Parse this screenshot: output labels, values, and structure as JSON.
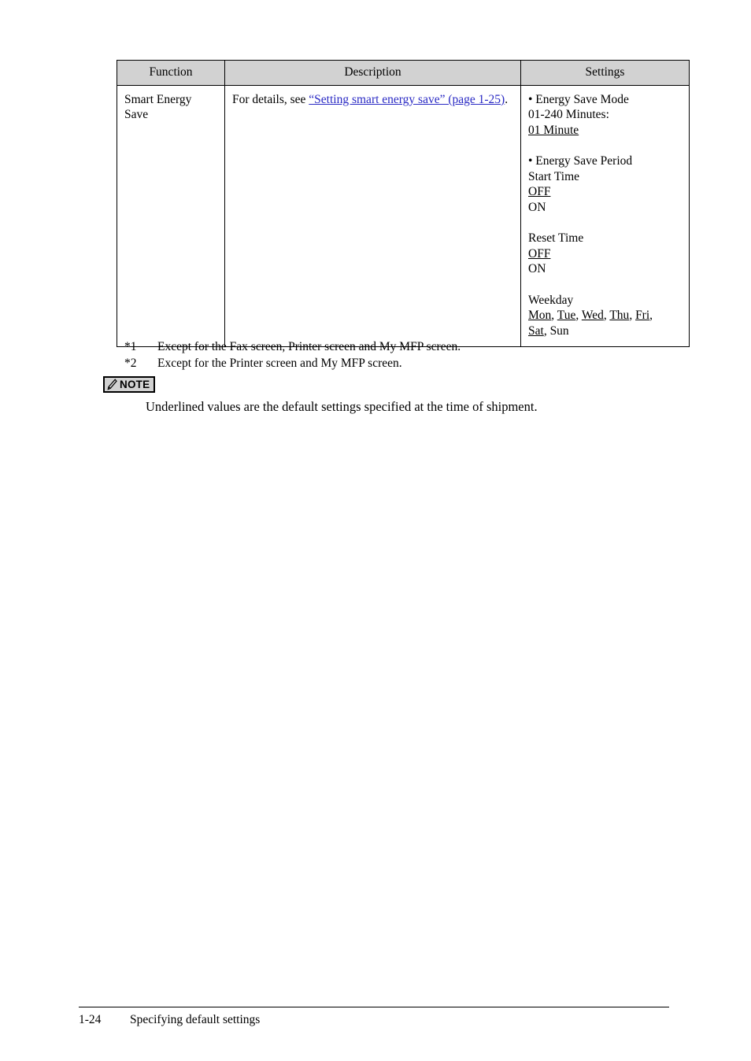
{
  "table": {
    "headers": {
      "function": "Function",
      "description": "Description",
      "settings": "Settings"
    },
    "row": {
      "function": "Smart Energy Save",
      "description": {
        "lead": "For details, see ",
        "link": "“Setting smart energy save” (page 1-25)",
        "trail": "."
      },
      "settings": {
        "group1": {
          "title": "• Energy Save Mode",
          "range": "01-240 Minutes:",
          "default": "01 Minute"
        },
        "group2": {
          "title": "• Energy Save Period",
          "start_time_label": "Start Time",
          "start_time_default": "OFF",
          "start_time_other": "ON",
          "reset_time_label": "Reset Time",
          "reset_time_default": "OFF",
          "reset_time_other": "ON",
          "weekday_label": "Weekday",
          "weekday_mon": "Mon",
          "weekday_sep1": ", ",
          "weekday_tue": "Tue",
          "weekday_sep2": ", ",
          "weekday_wed": "Wed",
          "weekday_sep3": ", ",
          "weekday_thu": "Thu",
          "weekday_sep4": ", ",
          "weekday_fri": "Fri",
          "weekday_sep5": ",",
          "weekday_sat": "Sat",
          "weekday_sep6": ", ",
          "weekday_sun": "Sun"
        }
      }
    }
  },
  "footnotes": [
    {
      "mark": "*1",
      "text": "Except for the Fax screen, Printer screen and My MFP screen."
    },
    {
      "mark": "*2",
      "text": "Except for the Printer screen and My MFP screen."
    }
  ],
  "note": {
    "icon": "pencil-icon",
    "label": "NOTE",
    "body": "Underlined values are the default settings specified at the time of shipment."
  },
  "footer": {
    "page": "1-24",
    "title": "Specifying default settings"
  },
  "colors": {
    "header_fill": "#d2d2d2",
    "link": "#2a2ac4",
    "rule": "#000000"
  }
}
